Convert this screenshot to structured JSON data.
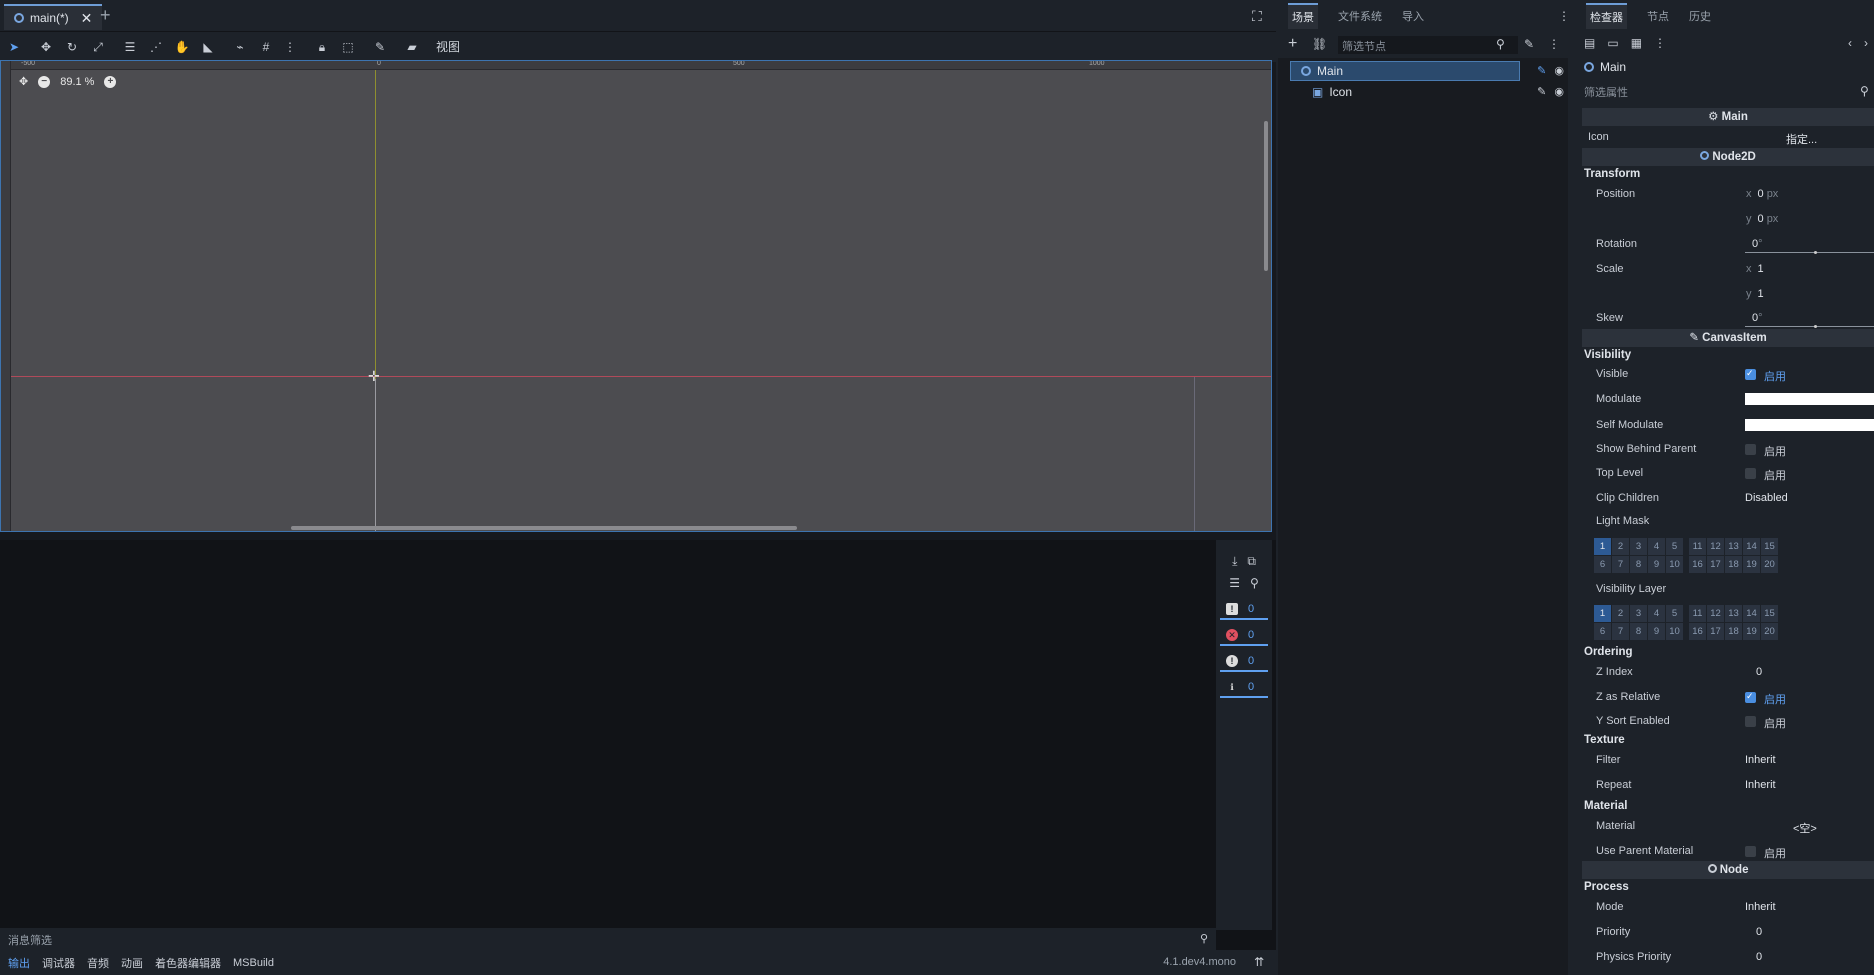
{
  "editor": {
    "scene_tab": "main(*)",
    "view_menu": "视图",
    "zoom": "89.1 %",
    "ruler_labels": [
      "-500",
      "0",
      "500",
      "1000"
    ]
  },
  "output": {
    "counters": [
      "0",
      "0",
      "0",
      "0"
    ],
    "filter_placeholder": "消息筛选",
    "bottom_tabs": [
      "输出",
      "调试器",
      "音频",
      "动画",
      "着色器编辑器",
      "MSBuild"
    ],
    "version": "4.1.dev4.mono"
  },
  "scene_dock": {
    "tabs": [
      "场景",
      "文件系统",
      "导入"
    ],
    "filter_placeholder": "筛选节点",
    "nodes": [
      {
        "name": "Main"
      },
      {
        "name": "Icon"
      }
    ]
  },
  "inspector": {
    "tabs": [
      "检查器",
      "节点",
      "历史"
    ],
    "object_name": "Main",
    "filter_placeholder": "筛选属性",
    "main_header": "Main",
    "icon_label": "Icon",
    "icon_value": "指定...",
    "node2d_header": "Node2D",
    "transform": {
      "title": "Transform",
      "position_label": "Position",
      "pos_x": "0",
      "pos_y": "0",
      "unit": "px",
      "rotation_label": "Rotation",
      "rotation": "0",
      "deg": "°",
      "scale_label": "Scale",
      "scale_x": "1",
      "scale_y": "1",
      "skew_label": "Skew",
      "skew": "0"
    },
    "canvasitem_header": "CanvasItem",
    "visibility": {
      "title": "Visibility",
      "visible_label": "Visible",
      "modulate_label": "Modulate",
      "self_modulate_label": "Self Modulate",
      "show_behind_label": "Show Behind Parent",
      "top_level_label": "Top Level",
      "clip_children_label": "Clip Children",
      "clip_children_value": "Disabled",
      "light_mask_label": "Light Mask",
      "visibility_layer_label": "Visibility Layer",
      "enable_text": "启用"
    },
    "layers_row1": [
      "1",
      "2",
      "3",
      "4",
      "5",
      "11",
      "12",
      "13",
      "14",
      "15"
    ],
    "layers_row2": [
      "6",
      "7",
      "8",
      "9",
      "10",
      "16",
      "17",
      "18",
      "19",
      "20"
    ],
    "ordering": {
      "title": "Ordering",
      "z_index_label": "Z Index",
      "z_index": "0",
      "z_relative_label": "Z as Relative",
      "y_sort_label": "Y Sort Enabled"
    },
    "texture": {
      "title": "Texture",
      "filter_label": "Filter",
      "filter_value": "Inherit",
      "repeat_label": "Repeat",
      "repeat_value": "Inherit"
    },
    "material": {
      "title": "Material",
      "material_label": "Material",
      "material_value": "<空>",
      "use_parent_label": "Use Parent Material"
    },
    "node_header": "Node",
    "process": {
      "title": "Process",
      "mode_label": "Mode",
      "mode_value": "Inherit",
      "priority_label": "Priority",
      "priority": "0",
      "physics_priority_label": "Physics Priority",
      "physics_priority": "0"
    }
  }
}
